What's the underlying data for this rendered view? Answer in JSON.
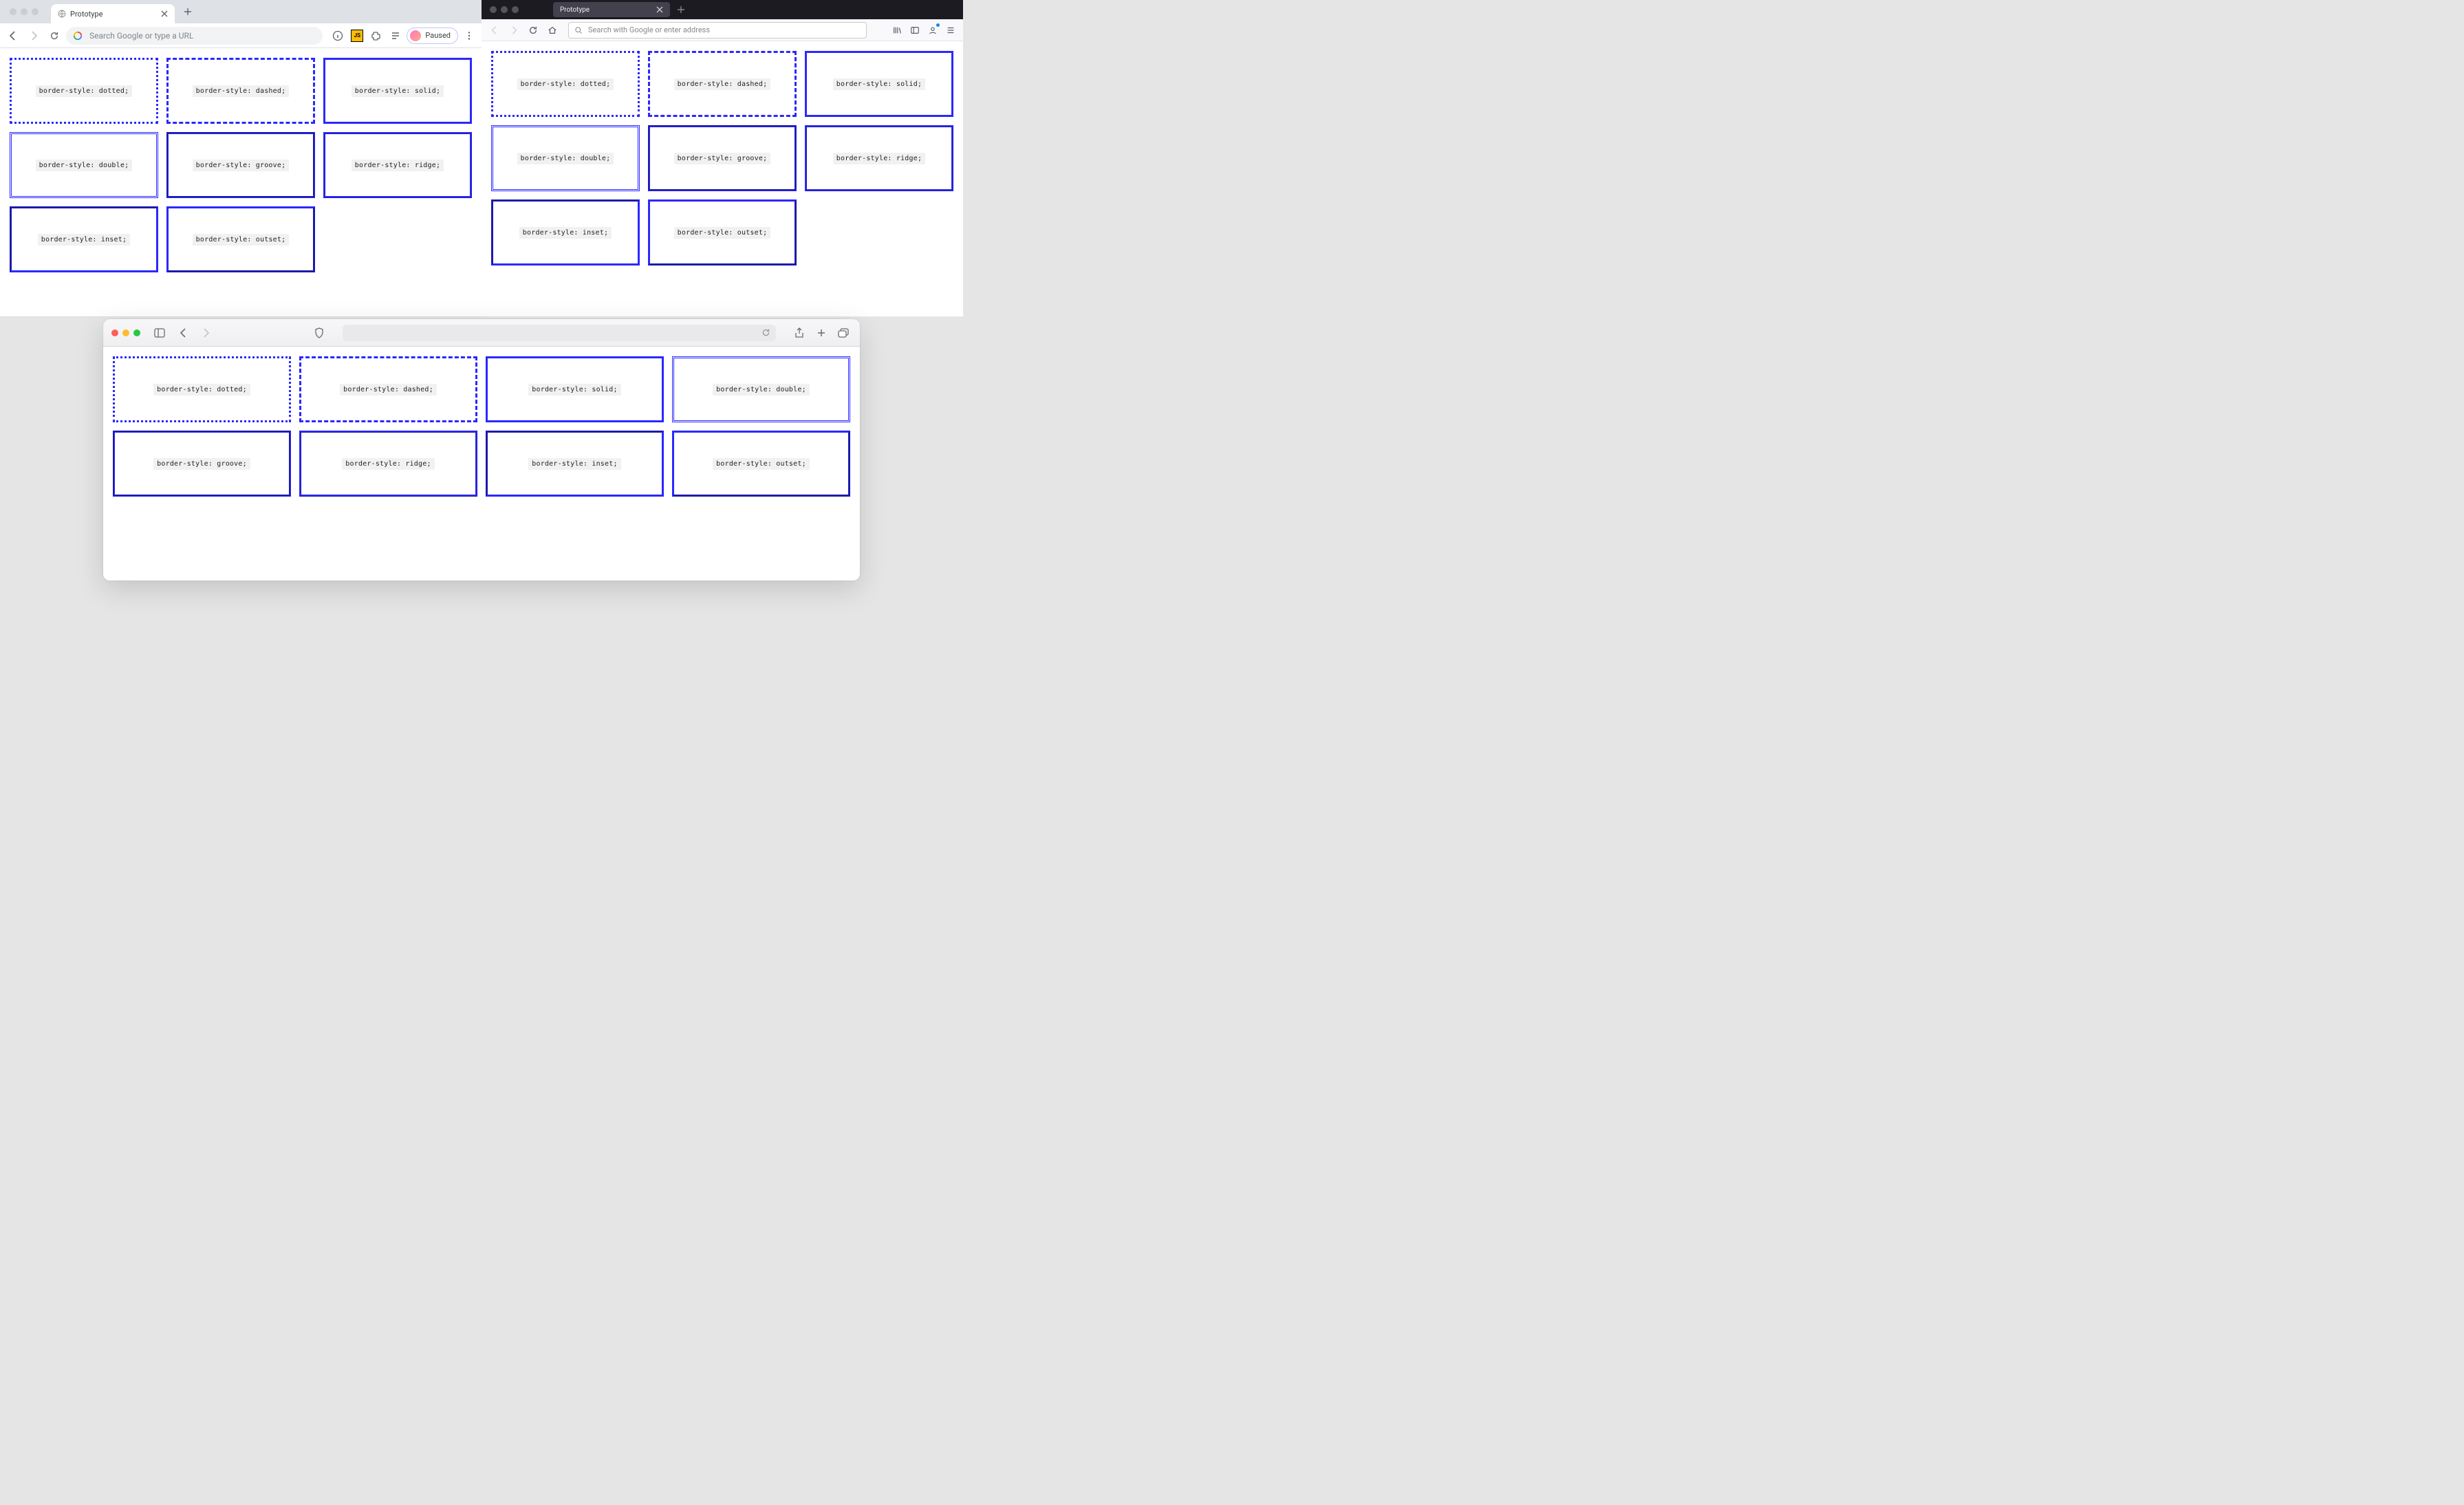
{
  "chrome": {
    "tab_title": "Prototype",
    "omnibox_placeholder": "Search Google or type a URL",
    "profile_status_label": "Paused",
    "toolbar_icons": {
      "info": "info-icon",
      "ext_js": "JS",
      "extensions": "puzzle-icon",
      "reading_list": "readinglist-icon",
      "menu": "more-icon"
    }
  },
  "firefox": {
    "tab_title": "Prototype",
    "urlbar_placeholder": "Search with Google or enter address",
    "toolbar_icons": {
      "library": "library-icon",
      "sidebar": "sidebar-icon",
      "account": "account-icon",
      "menu": "hamburger-icon"
    }
  },
  "safari": {
    "urlbar_value": "",
    "toolbar_icons": {
      "sidebar": "sidebar-icon",
      "shield": "shield-icon",
      "reload": "reload-icon",
      "share": "share-icon",
      "newtab": "plus-icon",
      "tabs": "tabs-icon"
    }
  },
  "border_demo": {
    "styles": [
      {
        "style": "dotted",
        "label": "border-style: dotted;"
      },
      {
        "style": "dashed",
        "label": "border-style: dashed;"
      },
      {
        "style": "solid",
        "label": "border-style: solid;"
      },
      {
        "style": "double",
        "label": "border-style: double;"
      },
      {
        "style": "groove",
        "label": "border-style: groove;"
      },
      {
        "style": "ridge",
        "label": "border-style: ridge;"
      },
      {
        "style": "inset",
        "label": "border-style: inset;"
      },
      {
        "style": "outset",
        "label": "border-style: outset;"
      }
    ],
    "border_color": "#2b28ff"
  }
}
